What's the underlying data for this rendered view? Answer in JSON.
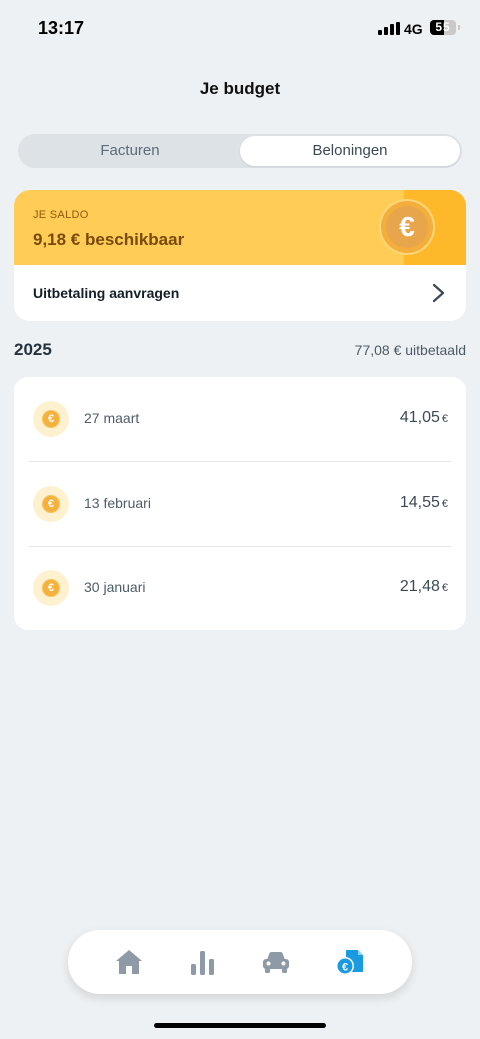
{
  "status_bar": {
    "time": "13:17",
    "network": "4G",
    "battery_level": "55"
  },
  "header": {
    "title": "Je budget"
  },
  "tabs": [
    {
      "label": "Facturen",
      "selected": false
    },
    {
      "label": "Beloningen",
      "selected": true
    }
  ],
  "saldo": {
    "label": "JE SALDO",
    "amount": "9,18 € beschikbaar",
    "coin_symbol": "€",
    "payout_label": "Uitbetaling aanvragen"
  },
  "year_section": {
    "year": "2025",
    "total": "77,08 € uitbetaald"
  },
  "payouts": [
    {
      "date": "27 maart",
      "amount": "41,05",
      "currency": "€"
    },
    {
      "date": "13 februari",
      "amount": "14,55",
      "currency": "€"
    },
    {
      "date": "30 januari",
      "amount": "21,48",
      "currency": "€"
    }
  ],
  "bottom_nav": [
    {
      "icon": "home-icon",
      "active": false
    },
    {
      "icon": "bar-chart-icon",
      "active": false
    },
    {
      "icon": "car-icon",
      "active": false
    },
    {
      "icon": "euro-document-icon",
      "active": true
    }
  ],
  "colors": {
    "background": "#eef1f3",
    "saldo_yellow": "#ffcd55",
    "saldo_text": "#7a4a0c",
    "nav_inactive": "#8e9aa6",
    "nav_active": "#1a9ae0"
  }
}
